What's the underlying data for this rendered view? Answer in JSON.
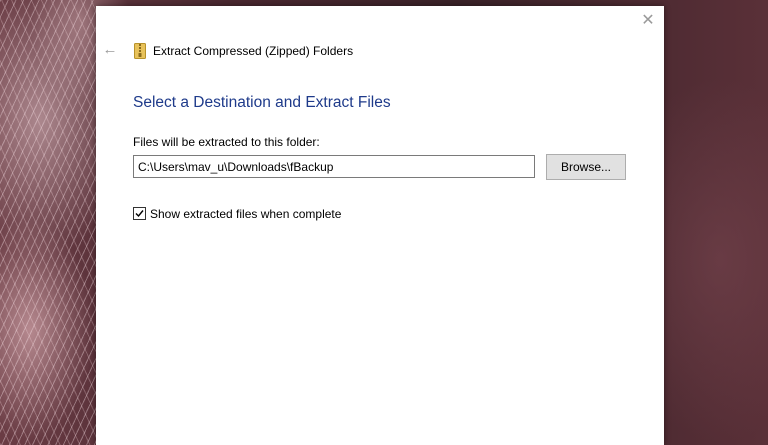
{
  "window": {
    "title": "Extract Compressed (Zipped) Folders",
    "close_glyph": "✕",
    "back_glyph": "←"
  },
  "content": {
    "heading": "Select a Destination and Extract Files",
    "destination_label": "Files will be extracted to this folder:",
    "destination_path": "C:\\Users\\mav_u\\Downloads\\fBackup",
    "browse_label": "Browse...",
    "show_files_label": "Show extracted files when complete",
    "show_files_checked": true
  },
  "colors": {
    "heading": "#1e3a8a",
    "zip_icon_folder": "#e8c25a",
    "zip_icon_zipper": "#8a6a1a"
  },
  "icons": {
    "title": "zip-folder-icon",
    "back": "back-arrow-icon",
    "close": "close-icon",
    "checkbox": "checkmark-icon"
  }
}
